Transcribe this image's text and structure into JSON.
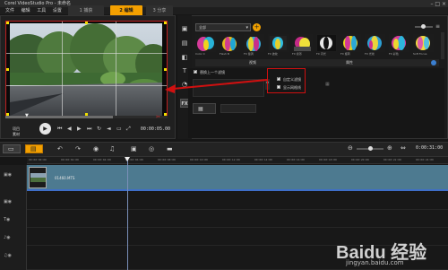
{
  "app": {
    "title": "Corel VideoStudio Pro - 未命名",
    "menu": [
      "文件",
      "编辑",
      "工具",
      "设置"
    ]
  },
  "steps": [
    {
      "label": "1 捕获",
      "active": false
    },
    {
      "label": "2 编辑",
      "active": true
    },
    {
      "label": "3 分享",
      "active": false
    }
  ],
  "preview": {
    "project_label": "项目",
    "clip_label": "素材",
    "timecode": "00:00:05.00"
  },
  "library": {
    "gallery": "全部",
    "thumbnails": [
      "Color C",
      "Flash B",
      "FX 漩涡",
      "FX 波纹",
      "FX 遮罩",
      "FX 闪光",
      "FX 旋转",
      "FX 光线",
      "FX 彩色",
      "Soft Focus"
    ],
    "tabs": [
      "视频",
      "属性"
    ],
    "replace_last_filter": "替换上一个滤镜",
    "custom_filter": "自定义滤镜",
    "split_screen": "显示网格线"
  },
  "timeline": {
    "time": "0:00:31:00",
    "ruler_ticks": [
      "00:00:00:00",
      "00:00:02:00",
      "00:00:04:00",
      "00:00:06:00",
      "00:00:08:00",
      "00:00:10:00",
      "00:00:12:00",
      "00:00:14:00",
      "00:00:16:00",
      "00:00:18:00",
      "00:00:20:00",
      "00:00:22:00",
      "00:00:24:00"
    ],
    "clip_name": "01460.MTS"
  },
  "watermark": {
    "brand": "Baidu 经验",
    "url": "jingyan.baidu.com"
  },
  "colors": {
    "accent": "#f4a000",
    "highlight_red": "#d01010",
    "track": "#4d7a90"
  }
}
